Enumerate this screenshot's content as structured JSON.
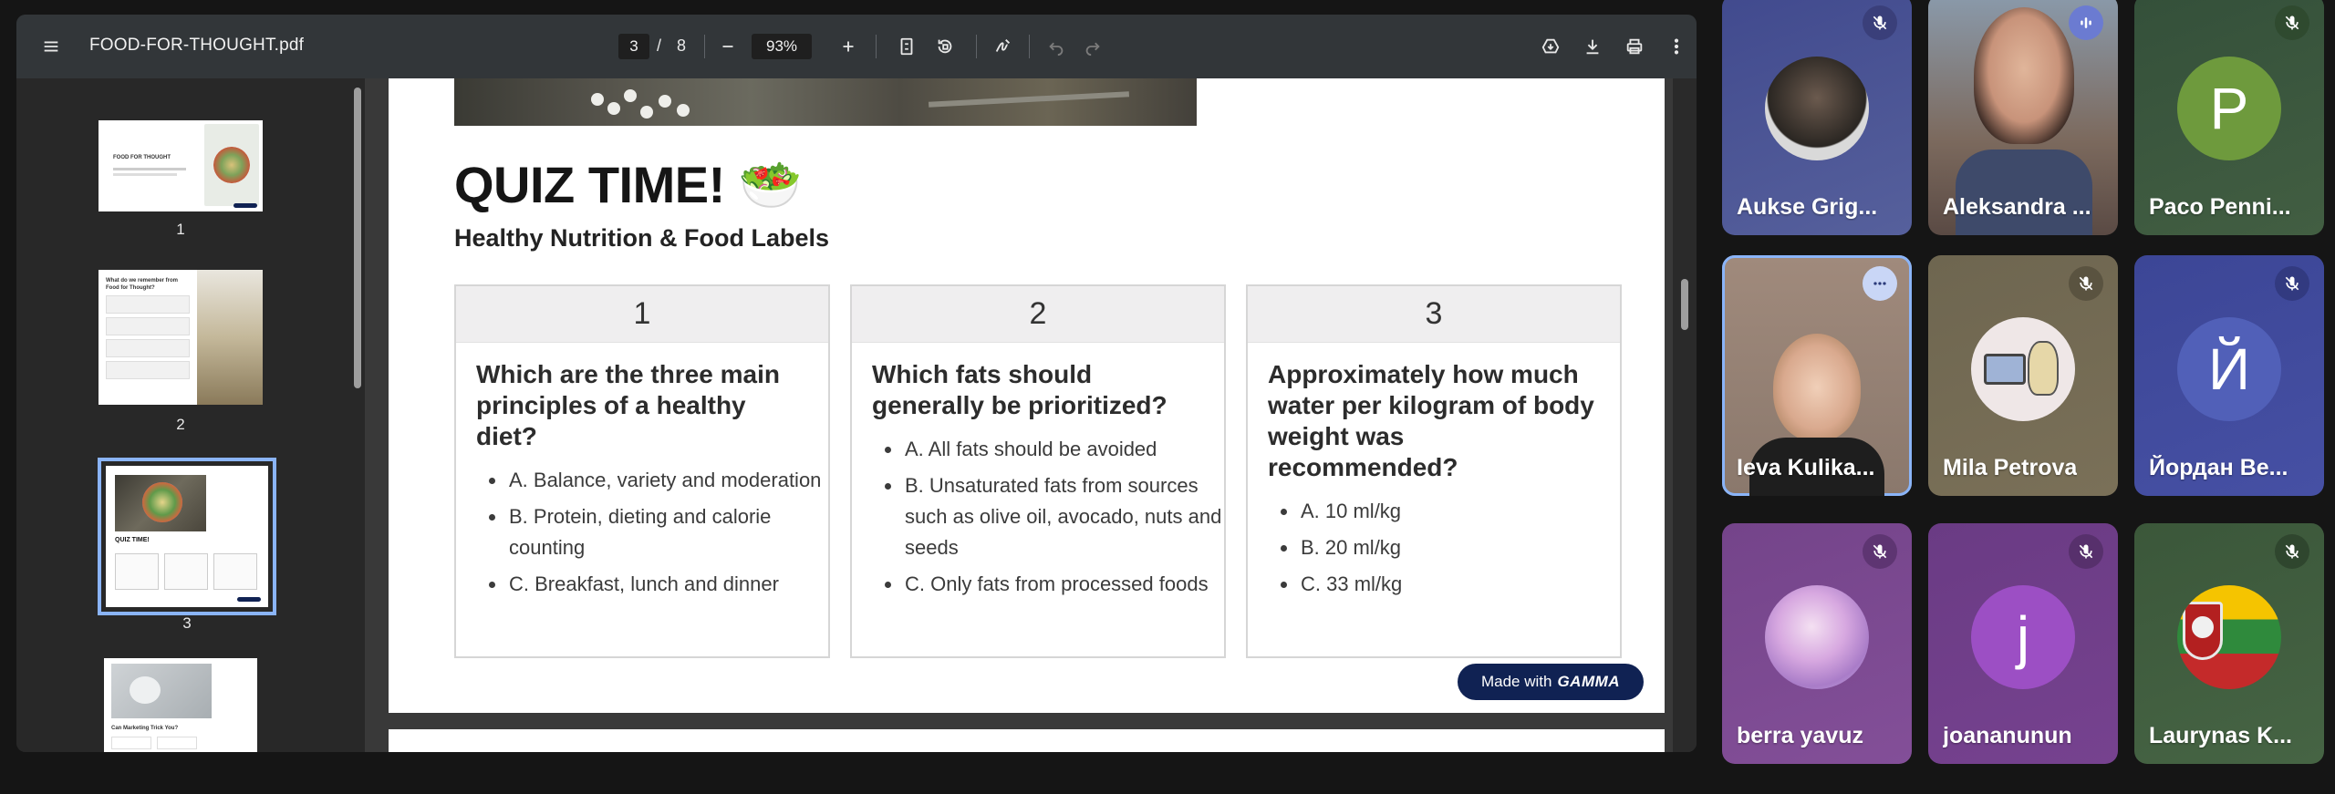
{
  "viewer": {
    "title": "FOOD-FOR-THOUGHT.pdf",
    "current_page": "3",
    "page_separator": "/",
    "total_pages": "8",
    "zoom": "93%"
  },
  "thumbnails": [
    {
      "number": "1",
      "title": "FOOD FOR THOUGHT"
    },
    {
      "number": "2",
      "title": "What do we remember from Food for Thought?"
    },
    {
      "number": "3",
      "title": "QUIZ TIME!"
    },
    {
      "number": "4",
      "title": "Can Marketing Trick You?"
    }
  ],
  "slide": {
    "title": "QUIZ TIME! 🥗",
    "subtitle": "Healthy Nutrition & Food Labels",
    "cards": [
      {
        "number": "1",
        "question": "Which are the three main principles of a healthy diet?",
        "options": [
          "A. Balance, variety and moderation",
          "B. Protein, dieting and calorie counting",
          "C. Breakfast, lunch and dinner"
        ]
      },
      {
        "number": "2",
        "question": "Which fats should generally be prioritized?",
        "options": [
          "A. All fats should be avoided",
          "B. Unsaturated fats from sources such as olive oil, avocado, nuts and seeds",
          "C. Only fats from processed foods"
        ]
      },
      {
        "number": "3",
        "question": "Approximately how much water per kilogram of body weight was recommended?",
        "options": [
          "A. 10 ml/kg",
          "B. 20 ml/kg",
          "C. 33 ml/kg"
        ]
      }
    ],
    "badge_prefix": "Made with",
    "badge_brand": "GAMMA"
  },
  "participants": [
    {
      "name": "Aukse Grig...",
      "mic": "muted",
      "bg": "#4a4f8c"
    },
    {
      "name": "Aleksandra ...",
      "mic": "speaking",
      "bg": "#5b6c8a"
    },
    {
      "name": "Paco Penni...",
      "mic": "muted",
      "bg": "#3d5a3a",
      "initial": "P",
      "avatar_color": "#6e9a3d"
    },
    {
      "name": "Ieva Kulika...",
      "mic": "more",
      "bg": "#8a7466"
    },
    {
      "name": "Mila Petrova",
      "mic": "muted",
      "bg": "#6e6650"
    },
    {
      "name": "Йордан Ве...",
      "mic": "muted",
      "bg": "#3f4a9a",
      "initial": "Й",
      "avatar_color": "#5160b8"
    },
    {
      "name": "berra yavuz",
      "mic": "muted",
      "bg": "#7a4a8c"
    },
    {
      "name": "joananunun",
      "mic": "muted",
      "bg": "#6c3e86",
      "initial": "j",
      "avatar_color": "#9c4fc4"
    },
    {
      "name": "Laurynas K...",
      "mic": "muted",
      "bg": "#3e5a3c"
    }
  ],
  "colors": {
    "accent_blue": "#8ab4f8",
    "badge_navy": "#102253",
    "toolbar": "#323639"
  }
}
